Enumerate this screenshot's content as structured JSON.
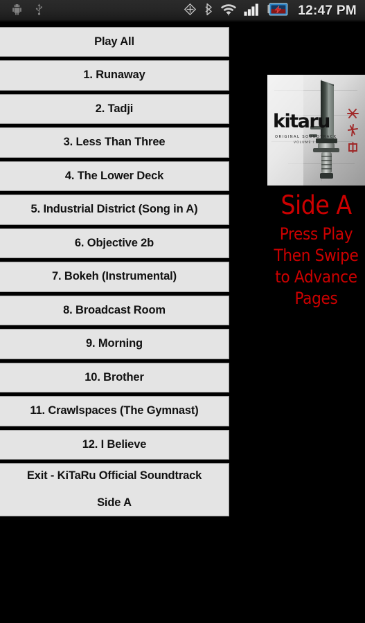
{
  "statusbar": {
    "left_icons": [
      {
        "name": "android-robot-icon",
        "label": "Android"
      },
      {
        "name": "usb-icon",
        "label": "USB connected"
      }
    ],
    "right_icons": [
      {
        "name": "gps-location-icon",
        "label": "GPS"
      },
      {
        "name": "bluetooth-icon",
        "label": "Bluetooth"
      },
      {
        "name": "wifi-icon",
        "label": "Wi-Fi"
      },
      {
        "name": "cellular-signal-icon",
        "label": "Signal"
      },
      {
        "name": "battery-charging-icon",
        "label": "Battery charging"
      }
    ],
    "clock": "12:47 PM",
    "background_color": "#262626",
    "text_color": "#e8e8e8"
  },
  "tracklist": {
    "buttons": [
      {
        "label": "Play All",
        "lines": [
          "Play All"
        ]
      },
      {
        "label": "1. Runaway",
        "lines": [
          "1. Runaway"
        ]
      },
      {
        "label": "2. Tadji",
        "lines": [
          "2. Tadji"
        ]
      },
      {
        "label": "3. Less Than Three",
        "lines": [
          "3. Less Than Three"
        ]
      },
      {
        "label": "4. The Lower Deck",
        "lines": [
          "4. The Lower Deck"
        ]
      },
      {
        "label": "5. Industrial District (Song in A)",
        "lines": [
          "5. Industrial District (Song in A)"
        ]
      },
      {
        "label": "6. Objective 2b",
        "lines": [
          "6. Objective 2b"
        ]
      },
      {
        "label": "7. Bokeh (Instrumental)",
        "lines": [
          "7. Bokeh (Instrumental)"
        ]
      },
      {
        "label": "8. Broadcast Room",
        "lines": [
          "8. Broadcast Room"
        ]
      },
      {
        "label": "9. Morning",
        "lines": [
          "9. Morning"
        ]
      },
      {
        "label": "10. Brother",
        "lines": [
          "10. Brother"
        ]
      },
      {
        "label": "11. Crawlspaces (The Gymnast)",
        "lines": [
          "11. Crawlspaces (The Gymnast)"
        ]
      },
      {
        "label": "12. I Believe",
        "lines": [
          "12. I Believe"
        ]
      },
      {
        "label": "Exit - KiTaRu Official Soundtrack Side A",
        "lines": [
          "Exit - KiTaRu Official Soundtrack",
          "Side A"
        ]
      }
    ],
    "button_color": "#e4e4e4",
    "button_text_color": "#111111"
  },
  "right_panel": {
    "album_art": {
      "title": "kitaru",
      "subtitle_line1": "ORIGINAL SOUNDTRACK",
      "subtitle_line2": "VOLUME I"
    },
    "side_label": "Side A",
    "instructions": [
      "Press Play",
      "Then Swipe",
      "to Advance",
      "Pages"
    ],
    "accent_color": "#cc0000"
  }
}
